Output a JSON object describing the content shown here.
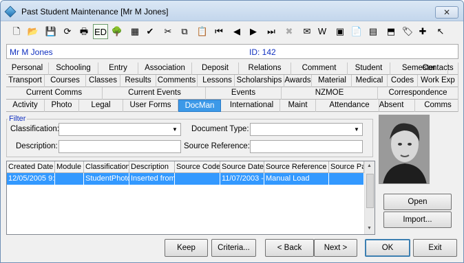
{
  "window": {
    "title": "Past Student Maintenance  [Mr M Jones]",
    "close_symbol": "✕"
  },
  "toolbar": {
    "buttons": [
      {
        "name": "new-icon",
        "glyph": "🗋"
      },
      {
        "name": "open-icon",
        "glyph": "📂"
      },
      {
        "name": "save-icon",
        "glyph": "💾"
      },
      {
        "name": "refresh-icon",
        "glyph": "⟳"
      },
      {
        "name": "print-icon",
        "glyph": "🖶"
      },
      {
        "name": "edit-mode-icon",
        "glyph": "ED"
      },
      {
        "name": "tree-icon",
        "glyph": "🌳"
      },
      {
        "name": "calculator-icon",
        "glyph": "▦"
      },
      {
        "name": "spellcheck-icon",
        "glyph": "✔"
      },
      {
        "name": "cut-icon",
        "glyph": "✂"
      },
      {
        "name": "copy-icon",
        "glyph": "⧉"
      },
      {
        "name": "paste-icon",
        "glyph": "📋"
      },
      {
        "name": "first-record-icon",
        "glyph": "⏮"
      },
      {
        "name": "previous-record-icon",
        "glyph": "◀"
      },
      {
        "name": "next-record-icon",
        "glyph": "▶"
      },
      {
        "name": "last-record-icon",
        "glyph": "⏭"
      },
      {
        "name": "delete-icon",
        "glyph": "✖"
      },
      {
        "name": "email-icon",
        "glyph": "✉"
      },
      {
        "name": "word-icon",
        "glyph": "W"
      },
      {
        "name": "excel-icon",
        "glyph": "▣"
      },
      {
        "name": "clipboard-icon",
        "glyph": "📄"
      },
      {
        "name": "calendar-icon",
        "glyph": "▤"
      },
      {
        "name": "stamp-icon",
        "glyph": "⬒"
      },
      {
        "name": "tag-icon",
        "glyph": "🏷"
      },
      {
        "name": "add-note-icon",
        "glyph": "✚"
      },
      {
        "name": "pointer-icon",
        "glyph": "↖"
      }
    ]
  },
  "student": {
    "name": "Mr M Jones",
    "id_label": "ID: 142"
  },
  "tabs": {
    "row1": [
      "Personal",
      "Schooling",
      "Entry",
      "Association",
      "Deposit",
      "Relations",
      "Comment",
      "Student",
      "Semester",
      "Contacts"
    ],
    "row2": [
      "Transport",
      "Courses",
      "Classes",
      "Results",
      "Comments",
      "Lessons",
      "Scholarships",
      "Awards",
      "Material",
      "Medical",
      "Codes",
      "Work Exp"
    ],
    "row3": [
      "Current Comms",
      "Current Events",
      "Events",
      "NZMOE",
      "Correspondence"
    ],
    "row4": [
      "Activity",
      "Photo",
      "Legal",
      "User Forms",
      "DocMan",
      "International",
      "Maint",
      "Attendance",
      "Absent",
      "Comms"
    ],
    "selected": "DocMan"
  },
  "filter": {
    "legend": "Filter",
    "classification_label": "Classification:",
    "classification_value": "",
    "document_type_label": "Document Type:",
    "document_type_value": "",
    "description_label": "Description:",
    "description_value": "",
    "source_reference_label": "Source Reference:",
    "source_reference_value": ""
  },
  "grid": {
    "columns": [
      "Created Date",
      "Module",
      "Classification",
      "Description",
      "Source Code",
      "Source Date",
      "Source Reference",
      "Source Pa"
    ],
    "rows": [
      [
        "12/05/2005 9:",
        "",
        "StudentPhoto",
        "Inserted from",
        "",
        "11/07/2003 -",
        "Manual Load",
        ""
      ]
    ]
  },
  "side_buttons": {
    "open": "Open",
    "import": "Import..."
  },
  "footer_buttons": {
    "keep": "Keep",
    "criteria": "Criteria...",
    "back": "< Back",
    "next": "Next >",
    "ok": "OK",
    "exit": "Exit"
  }
}
